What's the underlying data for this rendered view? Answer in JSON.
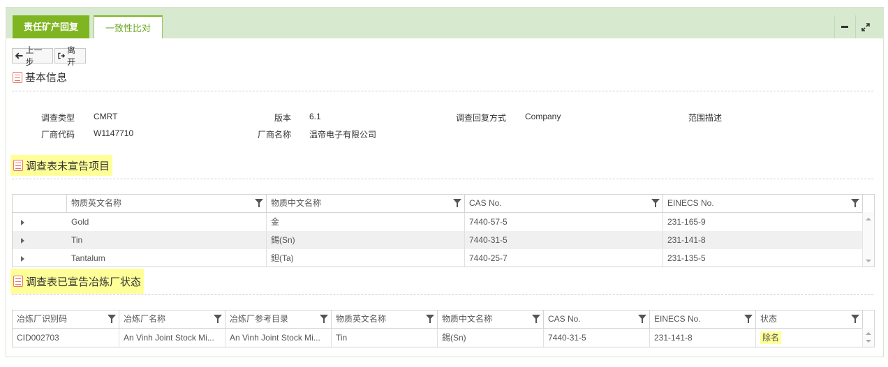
{
  "tabs": [
    {
      "label": "责任矿产回复"
    },
    {
      "label": "一致性比对"
    }
  ],
  "toolbar": {
    "prev_label": "上一步",
    "leave_label": "离开"
  },
  "basic_info": {
    "title": "基本信息",
    "fields": {
      "survey_type_label": "调查类型",
      "survey_type_value": "CMRT",
      "version_label": "版本",
      "version_value": "6.1",
      "reply_mode_label": "调查回复方式",
      "reply_mode_value": "Company",
      "scope_label": "范围描述",
      "vendor_code_label": "厂商代码",
      "vendor_code_value": "W1147710",
      "vendor_name_label": "厂商名称",
      "vendor_name_value": "温帝电子有限公司"
    }
  },
  "undeclared": {
    "title": "调查表未宣告项目",
    "columns": [
      "物质英文名称",
      "物质中文名称",
      "CAS No.",
      "EINECS No."
    ],
    "rows": [
      [
        "Gold",
        "金",
        "7440-57-5",
        "231-165-9"
      ],
      [
        "Tin",
        "錫(Sn)",
        "7440-31-5",
        "231-141-8"
      ],
      [
        "Tantalum",
        "鉭(Ta)",
        "7440-25-7",
        "231-135-5"
      ]
    ]
  },
  "declared": {
    "title": "调查表已宣告冶炼厂状态",
    "columns": [
      "冶炼厂识别码",
      "冶炼厂名称",
      "冶炼厂参考目录",
      "物质英文名称",
      "物质中文名称",
      "CAS No.",
      "EINECS No.",
      "状态"
    ],
    "rows": [
      [
        "CID002703",
        "An Vinh Joint Stock Mi...",
        "An Vinh Joint Stock Mi...",
        "Tin",
        "錫(Sn)",
        "7440-31-5",
        "231-141-8",
        "除名"
      ]
    ]
  },
  "colors": {
    "tab_active": "#7fb521",
    "tab_bar": "#d7e9cf",
    "highlight": "#ffff99",
    "section_icon": "#e8756a"
  }
}
